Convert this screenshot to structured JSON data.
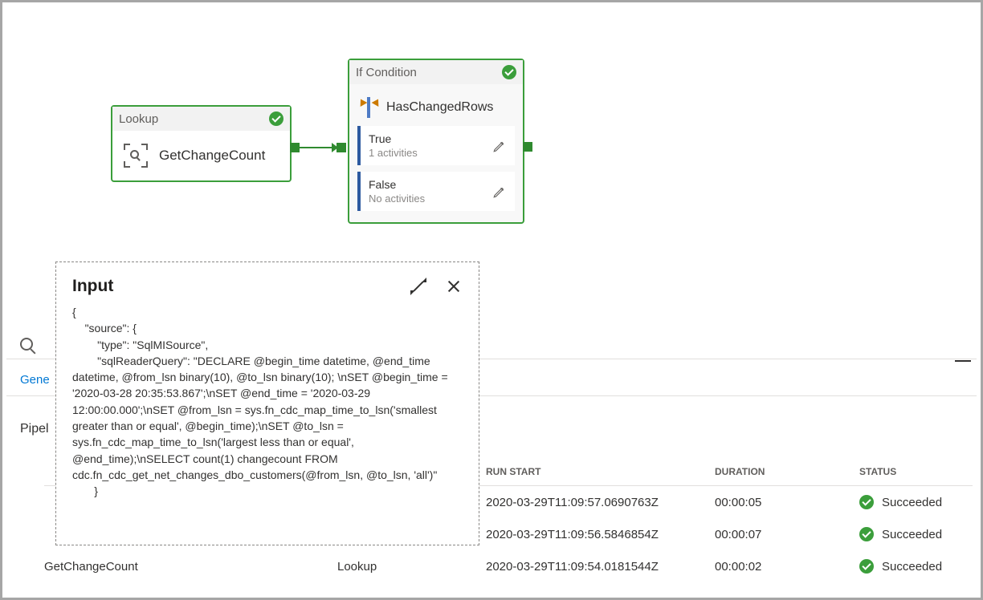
{
  "nodes": {
    "lookup": {
      "header": "Lookup",
      "title": "GetChangeCount"
    },
    "ifcond": {
      "header": "If Condition",
      "title": "HasChangedRows",
      "true_label": "True",
      "true_sub": "1 activities",
      "false_label": "False",
      "false_sub": "No activities"
    }
  },
  "popup": {
    "title": "Input",
    "body": "{\n    \"source\": {\n        \"type\": \"SqlMISource\",\n        \"sqlReaderQuery\": \"DECLARE @begin_time datetime, @end_time datetime, @from_lsn binary(10), @to_lsn binary(10); \\nSET @begin_time = '2020-03-28 20:35:53.867';\\nSET @end_time = '2020-03-29 12:00:00.000';\\nSET @from_lsn = sys.fn_cdc_map_time_to_lsn('smallest greater than or equal', @begin_time);\\nSET @to_lsn = sys.fn_cdc_map_time_to_lsn('largest less than or equal', @end_time);\\nSELECT count(1) changecount FROM cdc.fn_cdc_get_net_changes_dbo_customers(@from_lsn, @to_lsn, 'all')\"\n       }"
  },
  "panel": {
    "gen_tab": "Gene",
    "pipe_label": "Pipel"
  },
  "table": {
    "headers": {
      "name": "",
      "type": "",
      "run_start": "RUN START",
      "duration": "DURATION",
      "status": "STATUS"
    },
    "rows": [
      {
        "name": "",
        "type": "",
        "run_start": "2020-03-29T11:09:57.0690763Z",
        "duration": "00:00:05",
        "status": "Succeeded"
      },
      {
        "name": "",
        "type": "",
        "run_start": "2020-03-29T11:09:56.5846854Z",
        "duration": "00:00:07",
        "status": "Succeeded"
      },
      {
        "name": "GetChangeCount",
        "type": "Lookup",
        "run_start": "2020-03-29T11:09:54.0181544Z",
        "duration": "00:00:02",
        "status": "Succeeded"
      }
    ]
  }
}
